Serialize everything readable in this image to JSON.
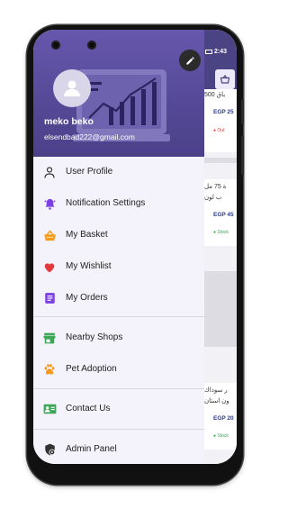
{
  "status_bar": {
    "time": "2:43"
  },
  "user": {
    "name": "meko beko",
    "email": "elsendbad222@gmail.com"
  },
  "menu": {
    "group1": [
      {
        "label": "User Profile",
        "icon": "person-icon"
      },
      {
        "label": "Notification Settings",
        "icon": "bell-icon"
      },
      {
        "label": "My Basket",
        "icon": "basket-icon"
      },
      {
        "label": "My Wishlist",
        "icon": "heart-icon"
      },
      {
        "label": "My Orders",
        "icon": "orders-icon"
      }
    ],
    "group2": [
      {
        "label": "Nearby Shops",
        "icon": "store-icon"
      },
      {
        "label": "Pet Adoption",
        "icon": "paw-icon"
      }
    ],
    "group3": [
      {
        "label": "Contact Us",
        "icon": "contact-card-icon"
      }
    ],
    "group4": [
      {
        "label": "Admin Panel",
        "icon": "admin-shield-icon"
      }
    ]
  },
  "background_app": {
    "cards": [
      {
        "title": "باق 500",
        "price": "EGP 25",
        "status": "Out"
      },
      {
        "title": "ة 75 مل",
        "title2": "ب لون",
        "price": "EGP 45",
        "status": "Stock"
      },
      {
        "title": "ر سوداك",
        "title2": "ون استان",
        "price": "EGP 20",
        "status": "Stock"
      }
    ]
  },
  "colors": {
    "header": "#564a98",
    "accent_purple": "#7b3fe4",
    "accent_orange": "#f59a1b",
    "accent_red": "#e23b3b",
    "accent_green": "#3aa857",
    "price_blue": "#2b3a8f"
  }
}
